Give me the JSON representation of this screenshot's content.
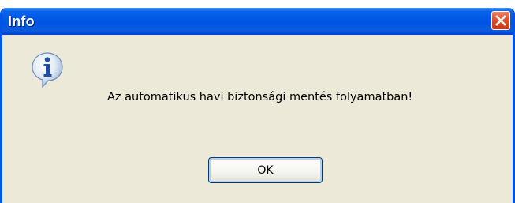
{
  "window": {
    "title": "Info"
  },
  "dialog": {
    "message": "Az automatikus havi biztonsági mentés folyamatban!",
    "icon": "info-icon",
    "ok_label": "OK"
  },
  "colors": {
    "titlebar": "#0054e3",
    "close_button": "#e0512e",
    "dialog_background": "#ece9d8"
  }
}
